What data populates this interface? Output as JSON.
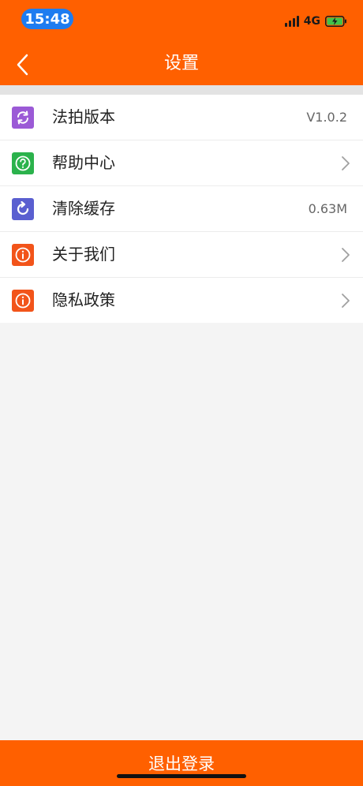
{
  "status_bar": {
    "time": "15:48",
    "network": "4G"
  },
  "header": {
    "title": "设置"
  },
  "settings": {
    "items": [
      {
        "label": "法拍版本",
        "value": "V1.0.2",
        "icon": "refresh-icon",
        "color": "#9b5ad6"
      },
      {
        "label": "帮助中心",
        "value": "",
        "icon": "question-icon",
        "color": "#2bb24c"
      },
      {
        "label": "清除缓存",
        "value": "0.63M",
        "icon": "rotate-icon",
        "color": "#5a5fd0"
      },
      {
        "label": "关于我们",
        "value": "",
        "icon": "info-icon",
        "color": "#f2541a"
      },
      {
        "label": "隐私政策",
        "value": "",
        "icon": "info-icon",
        "color": "#f2541a"
      }
    ]
  },
  "footer": {
    "logout_label": "退出登录"
  },
  "colors": {
    "brand": "#ff6000",
    "time_pill": "#1e7cf0",
    "background": "#f4f4f4"
  }
}
